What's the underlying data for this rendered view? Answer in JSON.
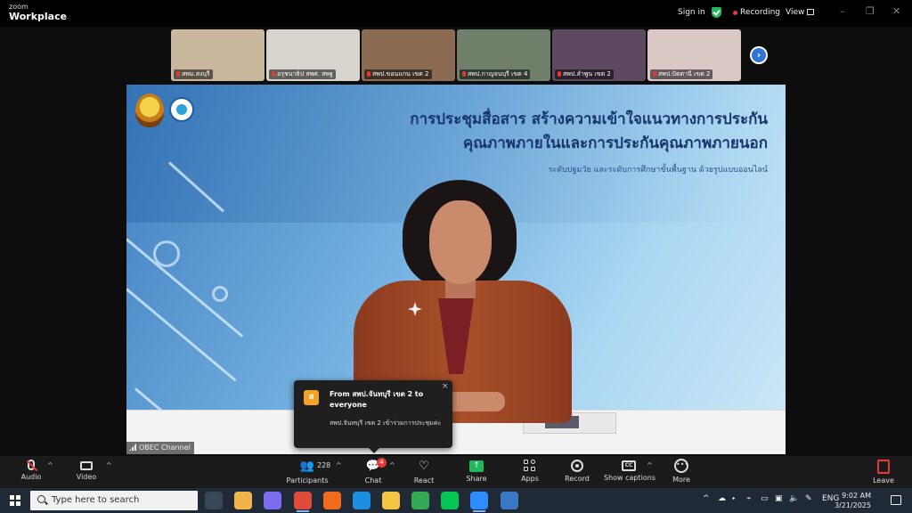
{
  "app": {
    "brand_top": "zoom",
    "brand_bottom": "Workplace",
    "signin_label": "Sign in",
    "recording_label": "Recording",
    "view_label": "View",
    "window_controls": [
      "–",
      "❐",
      "✕"
    ]
  },
  "participants": [
    {
      "name": "สพม.สงบุรี",
      "bg": "#c9b89d"
    },
    {
      "name": "อรุชนาธิป สพศ. สพฐ",
      "bg": "#d8d5cf"
    },
    {
      "name": "สพป.ขอนแกน เขต 2",
      "bg": "#8b6c52"
    },
    {
      "name": "สพป.กาญจนบุรี เขต 4",
      "bg": "#6f7f6a"
    },
    {
      "name": "สพป.ลำพูน เขต 2",
      "bg": "#5d4960"
    },
    {
      "name": "สพป.ปัตตานี เขต 2",
      "bg": "#d9c8c4"
    }
  ],
  "next_button_label": "›",
  "slide": {
    "title_line1": "การประชุมสื่อสาร สร้างความเข้าใจแนวทางการประกัน",
    "title_line2": "คุณภาพภายในและการประกันคุณภาพภายนอก",
    "subtitle": "ระดับปฐมวัย และระดับการศึกษาขั้นพื้นฐาน ด้วยรูปแบบออนไลน์"
  },
  "speaker_label": "OBEC Channel",
  "chat_toast": {
    "avatar_letter": "ส",
    "from": "From สพป.จันทบุรี เขต 2 to everyone",
    "message": "สพป.จันทบุรี เขต 2 เข้าร่วมการประชุมค่ะ",
    "close": "×"
  },
  "toolbar": {
    "audio": "Audio",
    "video": "Video",
    "participants": "Participants",
    "participants_count": "228",
    "chat": "Chat",
    "chat_badge": "4",
    "react": "React",
    "share": "Share",
    "apps": "Apps",
    "record": "Record",
    "captions": "Show captions",
    "more": "More",
    "leave": "Leave",
    "cc_text": "CC",
    "more_text": "•••",
    "caret": "^"
  },
  "taskbar": {
    "search_placeholder": "Type here to search",
    "language": "ENG",
    "time": "9:02 AM",
    "date": "3/21/2025",
    "tray_chevron": "^",
    "apps": [
      {
        "name": "task-view",
        "color": "#3a4756"
      },
      {
        "name": "file-explorer",
        "color": "#f0b44a"
      },
      {
        "name": "copilot",
        "color": "#7b6cf0"
      },
      {
        "name": "chrome",
        "color": "#e04a3b"
      },
      {
        "name": "rss-reader",
        "color": "#f26b1d"
      },
      {
        "name": "edge",
        "color": "#1c8fe0"
      },
      {
        "name": "folder",
        "color": "#f4c542"
      },
      {
        "name": "chrome-profile",
        "color": "#34a853"
      },
      {
        "name": "line",
        "color": "#06c755"
      },
      {
        "name": "zoom",
        "color": "#2d8cff"
      },
      {
        "name": "keepass",
        "color": "#3b78c4"
      }
    ]
  }
}
